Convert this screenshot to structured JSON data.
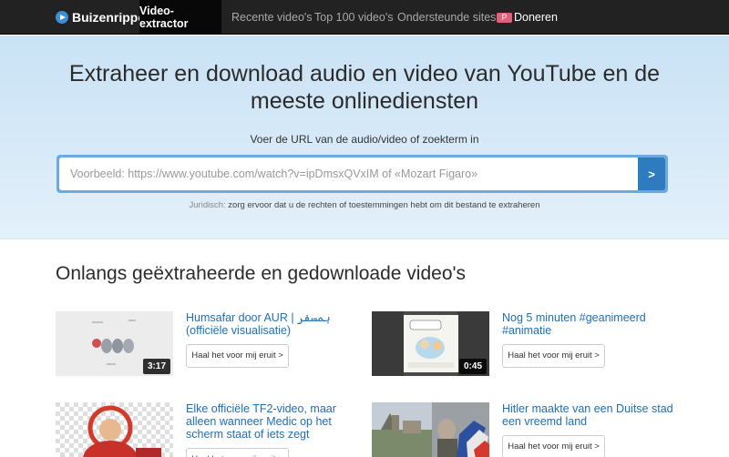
{
  "nav": {
    "brand": "Buizenripper",
    "items": [
      {
        "label": "Video-extractor"
      },
      {
        "label": "Recente video's"
      },
      {
        "label": "Top 100 video's"
      },
      {
        "label": "Ondersteunde sites"
      },
      {
        "label": "Doneren",
        "badge": "P"
      }
    ]
  },
  "hero": {
    "title": "Extraheer en download audio en video van YouTube en de meeste onlinediensten",
    "label": "Voer de URL van de audio/video of zoekterm in",
    "placeholder": "Voorbeeld: https://www.youtube.com/watch?v=ipDmsxQVxIM of «Mozart Figaro»",
    "button": ">",
    "legal_prefix": "Juridisch:",
    "legal_text": " zorg ervoor dat u de rechten of toestemmingen hebt om dit bestand te extraheren"
  },
  "recent": {
    "title": "Onlangs geëxtraheerde en gedownloade video's",
    "button_label": "Haal het voor mij eruit >",
    "videos": [
      {
        "title": "Humsafar door AUR | ہمسفر (officiële visualisatie)",
        "duration": "3:17"
      },
      {
        "title": "Nog 5 minuten #geanimeerd #animatie",
        "duration": "0:45"
      },
      {
        "title": "Elke officiële TF2-video, maar alleen wanneer Medic op het scherm staat of iets zegt",
        "duration": ""
      },
      {
        "title": "Hitler maakte van een Duitse stad een vreemd land",
        "duration": ""
      }
    ]
  },
  "colors": {
    "navbar": "#222222",
    "accent": "#2e7bc0",
    "link": "#1f6fb5"
  }
}
